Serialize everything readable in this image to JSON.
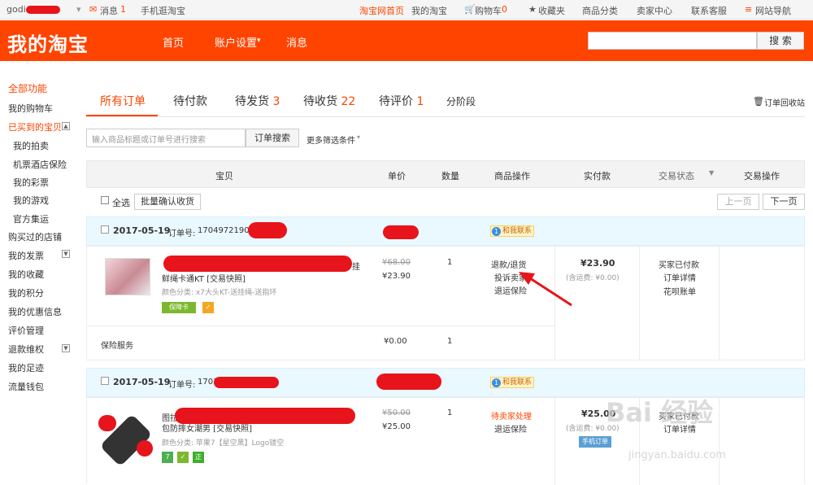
{
  "topbar": {
    "user": "godi",
    "messages": "消息",
    "messages_count": "1",
    "mobile": "手机逛淘宝",
    "home": "淘宝网首页",
    "my_taobao": "我的淘宝",
    "cart": "购物车",
    "cart_count": "0",
    "favorites": "收藏夹",
    "categories": "商品分类",
    "seller_center": "卖家中心",
    "service": "联系客服",
    "site_nav": "网站导航"
  },
  "header": {
    "logo": "我的淘宝",
    "nav": [
      "首页",
      "账户设置",
      "消息"
    ],
    "search_button": "搜 索"
  },
  "sidebar": {
    "items": [
      {
        "label": "全部功能",
        "style": "red-title"
      },
      {
        "label": "我的购物车",
        "style": "normal"
      },
      {
        "label": "已买到的宝贝",
        "style": "red"
      },
      {
        "label": "我的拍卖",
        "style": "sub"
      },
      {
        "label": "机票酒店保险",
        "style": "sub"
      },
      {
        "label": "我的彩票",
        "style": "sub"
      },
      {
        "label": "我的游戏",
        "style": "sub"
      },
      {
        "label": "官方集运",
        "style": "sub"
      },
      {
        "label": "购买过的店铺",
        "style": "normal"
      },
      {
        "label": "我的发票",
        "style": "normal"
      },
      {
        "label": "我的收藏",
        "style": "normal"
      },
      {
        "label": "我的积分",
        "style": "normal"
      },
      {
        "label": "我的优惠信息",
        "style": "normal"
      },
      {
        "label": "评价管理",
        "style": "normal"
      },
      {
        "label": "退款维权",
        "style": "normal"
      },
      {
        "label": "我的足迹",
        "style": "normal"
      },
      {
        "label": "流量钱包",
        "style": "normal"
      }
    ]
  },
  "tabs": [
    {
      "label": "所有订单",
      "count": ""
    },
    {
      "label": "待付款",
      "count": ""
    },
    {
      "label": "待发货",
      "count": "3"
    },
    {
      "label": "待收货",
      "count": "22"
    },
    {
      "label": "待评价",
      "count": "1"
    },
    {
      "label": "分阶段",
      "count": ""
    }
  ],
  "recycle": "订单回收站",
  "filter": {
    "placeholder": "输入商品标题或订单号进行搜索",
    "search_button": "订单搜索",
    "more": "更多筛选条件"
  },
  "table": {
    "columns": [
      "宝贝",
      "单价",
      "数量",
      "商品操作",
      "实付款",
      "交易状态",
      "交易操作"
    ],
    "select_all": "全选",
    "batch_confirm": "批量确认收货",
    "prev": "上一页",
    "next": "下一页"
  },
  "orders": [
    {
      "date": "2017-05-19",
      "order_label": "订单号:",
      "order_no": "17049721907",
      "contact": "和我联系",
      "title_suffix": "挂",
      "title_line2": "鲜绳卡通KT [交易快照]",
      "spec": "颜色分类: x7大头KT-送挂绳-送指环",
      "badge1": "保障卡",
      "original_price": "¥68.00",
      "price": "¥23.90",
      "qty": "1",
      "actions": [
        "退款/退货",
        "投诉卖家",
        "退运保险"
      ],
      "paid": "¥23.90",
      "shipping": "(含运费: ¥0.00)",
      "status": [
        "买家已付款",
        "订单详情",
        "花呗账单"
      ],
      "service_label": "保险服务",
      "service_price": "¥0.00",
      "service_qty": "1"
    },
    {
      "date": "2017-05-19",
      "order_label": "订单号:",
      "order_no": "1703",
      "contact": "和我联系",
      "title_prefix": "图拉",
      "title_line2": "包防摔女潮男 [交易快照]",
      "spec": "颜色分类: 苹果7【星空黑】Logo镂空",
      "original_price": "¥50.00",
      "price": "¥25.00",
      "qty": "1",
      "actions": [
        "待卖家处理",
        "退运保险"
      ],
      "paid": "¥25.00",
      "shipping": "(含运费: ¥0.00)",
      "mobile_badge": "手机订单",
      "status": [
        "买家已付款",
        "订单详情"
      ]
    }
  ],
  "watermark": {
    "main": "Bai 经验",
    "sub": "jingyan.baidu.com"
  },
  "colors": {
    "brand": "#ff4400",
    "redaction": "#e8141b",
    "arrow": "#e8141b"
  }
}
